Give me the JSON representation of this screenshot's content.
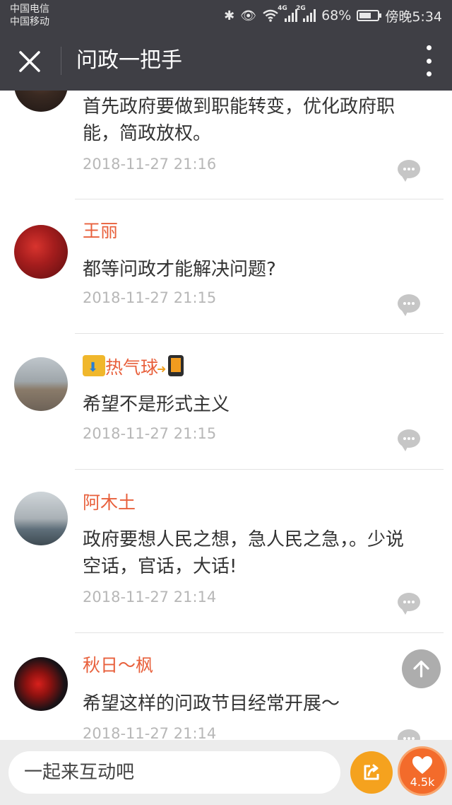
{
  "status_bar": {
    "carrier_1": "中国电信",
    "carrier_2": "中国移动",
    "net_1": "4G",
    "net_2": "2G",
    "battery": "68%",
    "battery_level": 0.68,
    "time": "傍晚5:34"
  },
  "header": {
    "title": "问政一把手",
    "background": "#3f3f45"
  },
  "comments": [
    {
      "author": "",
      "text": "首先政府要做到职能转变，优化政府职能，简政放权。",
      "time": "2018-11-27 21:16"
    },
    {
      "author": "王丽",
      "text": "都等问政才能解决问题?",
      "time": "2018-11-27 21:15"
    },
    {
      "author": "热气球",
      "text": "希望不是形式主义",
      "time": "2018-11-27 21:15"
    },
    {
      "author": "阿木土",
      "text": "政府要想人民之想，急人民之急，。少说空话，官话，大话!",
      "time": "2018-11-27 21:14"
    },
    {
      "author": "秋日～枫",
      "text": "希望这样的问政节目经常开展～",
      "time": "2018-11-27 21:14"
    }
  ],
  "bottom_bar": {
    "input_placeholder": "一起来互动吧",
    "like_count": "4.5k"
  },
  "colors": {
    "author": "#e8603c",
    "timestamp": "#b7b7b7",
    "share": "#f5a21e",
    "like": "#f36b2b"
  }
}
